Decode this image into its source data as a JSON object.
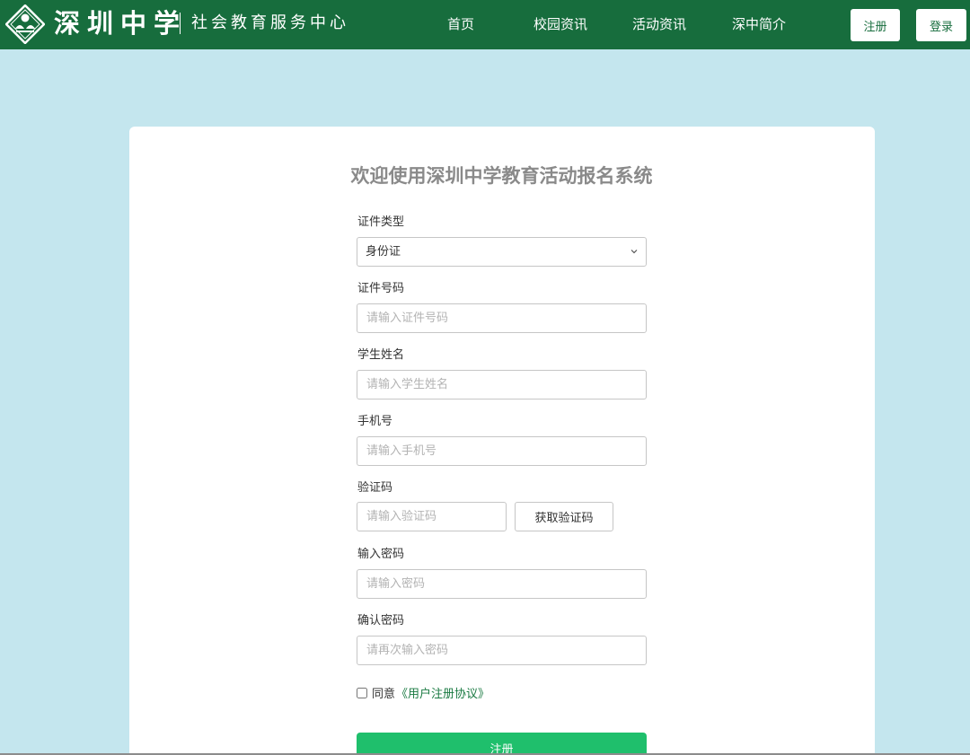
{
  "header": {
    "brand_name": "深圳中学",
    "brand_subtitle": "社会教育服务中心",
    "nav": {
      "home": "首页",
      "campus_news": "校园资讯",
      "activity_news": "活动资讯",
      "about": "深中简介"
    },
    "register_label": "注册",
    "login_label": "登录"
  },
  "form": {
    "title": "欢迎使用深圳中学教育活动报名系统",
    "id_type": {
      "label": "证件类型",
      "value": "身份证"
    },
    "id_number": {
      "label": "证件号码",
      "placeholder": "请输入证件号码"
    },
    "student_name": {
      "label": "学生姓名",
      "placeholder": "请输入学生姓名"
    },
    "phone": {
      "label": "手机号",
      "placeholder": "请输入手机号"
    },
    "verify_code": {
      "label": "验证码",
      "placeholder": "请输入验证码",
      "button_label": "获取验证码"
    },
    "password": {
      "label": "输入密码",
      "placeholder": "请输入密码"
    },
    "confirm_password": {
      "label": "确认密码",
      "placeholder": "请再次输入密码"
    },
    "agree": {
      "text": "同意",
      "link": "《用户注册协议》"
    },
    "submit_label": "注册"
  },
  "colors": {
    "header_bg": "#176d3d",
    "page_bg": "#c4e6ee",
    "submit_bg": "#1fbf6c",
    "link": "#1a7a42"
  },
  "icons": {
    "logo": "school-emblem-icon",
    "dropdown": "chevron-down-icon"
  }
}
